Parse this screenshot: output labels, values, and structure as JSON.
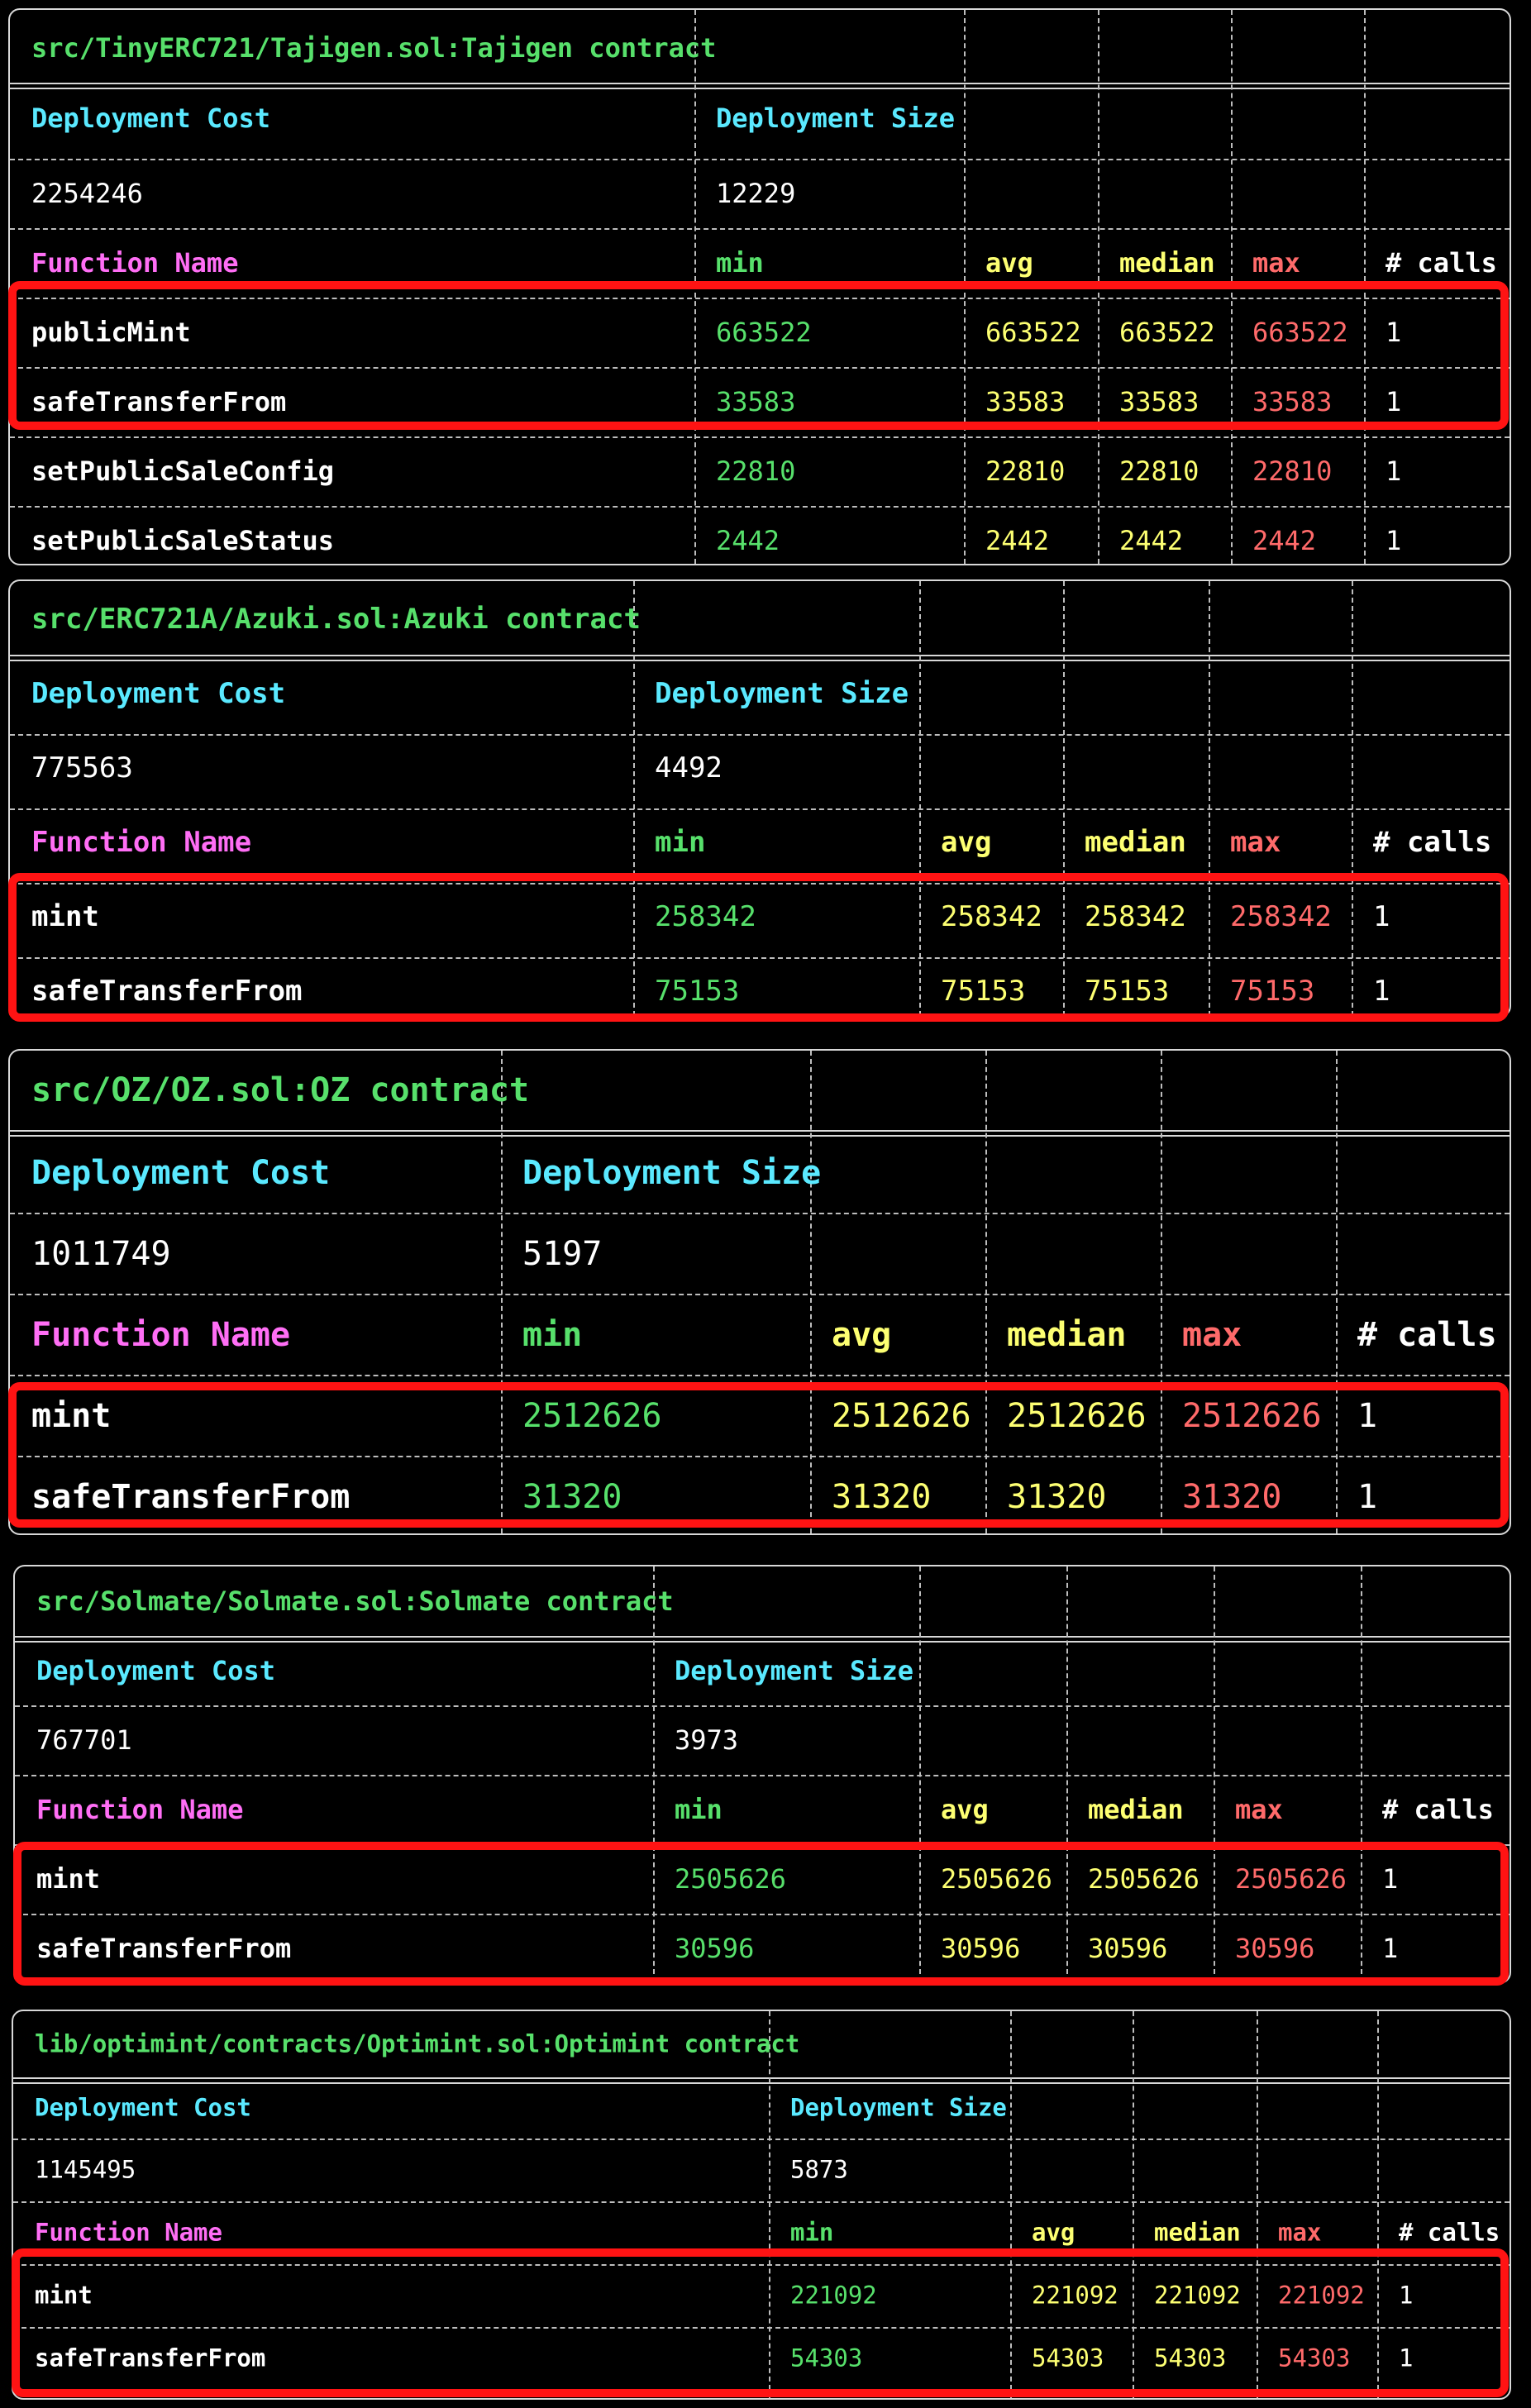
{
  "colors": {
    "background": "#000000",
    "title_green": "#57e06b",
    "header_cyan": "#5ae9ff",
    "header_magenta": "#ff6ef5",
    "value_yellow": "#fdff72",
    "value_red": "#ff6a6a",
    "highlight_red": "#ff1313"
  },
  "labels": {
    "deployment_cost": "Deployment Cost",
    "deployment_size": "Deployment Size",
    "function_name": "Function Name",
    "min": "min",
    "avg": "avg",
    "median": "median",
    "max": "max",
    "calls": "# calls"
  },
  "reports": [
    {
      "title": "src/TinyERC721/Tajigen.sol:Tajigen contract",
      "deployment_cost": "2254246",
      "deployment_size": "12229",
      "functions": [
        {
          "name": "publicMint",
          "min": "663522",
          "avg": "663522",
          "median": "663522",
          "max": "663522",
          "calls": "1"
        },
        {
          "name": "safeTransferFrom",
          "min": "33583",
          "avg": "33583",
          "median": "33583",
          "max": "33583",
          "calls": "1"
        },
        {
          "name": "setPublicSaleConfig",
          "min": "22810",
          "avg": "22810",
          "median": "22810",
          "max": "22810",
          "calls": "1"
        },
        {
          "name": "setPublicSaleStatus",
          "min": "2442",
          "avg": "2442",
          "median": "2442",
          "max": "2442",
          "calls": "1"
        }
      ]
    },
    {
      "title": "src/ERC721A/Azuki.sol:Azuki contract",
      "deployment_cost": "775563",
      "deployment_size": "4492",
      "functions": [
        {
          "name": "mint",
          "min": "258342",
          "avg": "258342",
          "median": "258342",
          "max": "258342",
          "calls": "1"
        },
        {
          "name": "safeTransferFrom",
          "min": "75153",
          "avg": "75153",
          "median": "75153",
          "max": "75153",
          "calls": "1"
        }
      ]
    },
    {
      "title": "src/OZ/OZ.sol:OZ contract",
      "deployment_cost": "1011749",
      "deployment_size": "5197",
      "functions": [
        {
          "name": "mint",
          "min": "2512626",
          "avg": "2512626",
          "median": "2512626",
          "max": "2512626",
          "calls": "1"
        },
        {
          "name": "safeTransferFrom",
          "min": "31320",
          "avg": "31320",
          "median": "31320",
          "max": "31320",
          "calls": "1"
        }
      ]
    },
    {
      "title": "src/Solmate/Solmate.sol:Solmate contract",
      "deployment_cost": "767701",
      "deployment_size": "3973",
      "functions": [
        {
          "name": "mint",
          "min": "2505626",
          "avg": "2505626",
          "median": "2505626",
          "max": "2505626",
          "calls": "1"
        },
        {
          "name": "safeTransferFrom",
          "min": "30596",
          "avg": "30596",
          "median": "30596",
          "max": "30596",
          "calls": "1"
        }
      ]
    },
    {
      "title": "lib/optimint/contracts/Optimint.sol:Optimint contract",
      "deployment_cost": "1145495",
      "deployment_size": "5873",
      "functions": [
        {
          "name": "mint",
          "min": "221092",
          "avg": "221092",
          "median": "221092",
          "max": "221092",
          "calls": "1"
        },
        {
          "name": "safeTransferFrom",
          "min": "54303",
          "avg": "54303",
          "median": "54303",
          "max": "54303",
          "calls": "1"
        }
      ]
    }
  ]
}
